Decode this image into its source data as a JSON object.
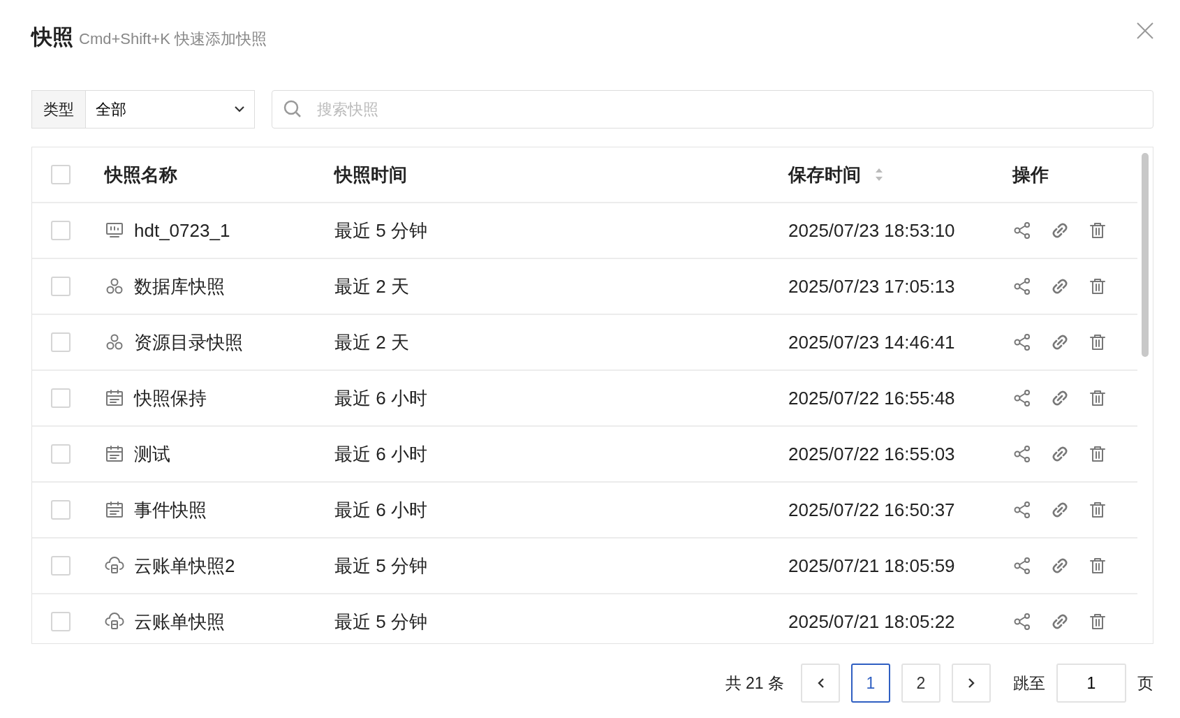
{
  "dialog": {
    "title": "快照",
    "hint": "Cmd+Shift+K 快速添加快照"
  },
  "filter": {
    "label": "类型",
    "value": "全部"
  },
  "search": {
    "placeholder": "搜索快照"
  },
  "table": {
    "columns": [
      "快照名称",
      "快照时间",
      "保存时间",
      "操作"
    ],
    "select_all": {
      "checked": false
    },
    "rows": [
      {
        "kind": "monitor",
        "name": "hdt_0723_1",
        "time": "最近 5 分钟",
        "saved": "2025/07/23 18:53:10",
        "checked": false
      },
      {
        "kind": "cluster",
        "name": "数据库快照",
        "time": "最近 2 天",
        "saved": "2025/07/23 17:05:13",
        "checked": false
      },
      {
        "kind": "cluster",
        "name": "资源目录快照",
        "time": "最近 2 天",
        "saved": "2025/07/23 14:46:41",
        "checked": false
      },
      {
        "kind": "calendar",
        "name": "快照保持",
        "time": "最近 6 小时",
        "saved": "2025/07/22 16:55:48",
        "checked": false
      },
      {
        "kind": "calendar",
        "name": "测试",
        "time": "最近 6 小时",
        "saved": "2025/07/22 16:55:03",
        "checked": false
      },
      {
        "kind": "calendar",
        "name": "事件快照",
        "time": "最近 6 小时",
        "saved": "2025/07/22 16:50:37",
        "checked": false
      },
      {
        "kind": "cloud",
        "name": "云账单快照2",
        "time": "最近 5 分钟",
        "saved": "2025/07/21 18:05:59",
        "checked": false
      },
      {
        "kind": "cloud",
        "name": "云账单快照",
        "time": "最近 5 分钟",
        "saved": "2025/07/21 18:05:22",
        "checked": false
      }
    ]
  },
  "pagination": {
    "total": "共 21 条",
    "pages": [
      {
        "label": "1",
        "selected": true
      },
      {
        "label": "2",
        "selected": false
      }
    ],
    "jump_label": "跳至",
    "jump_value": "1",
    "page_unit": "页"
  }
}
